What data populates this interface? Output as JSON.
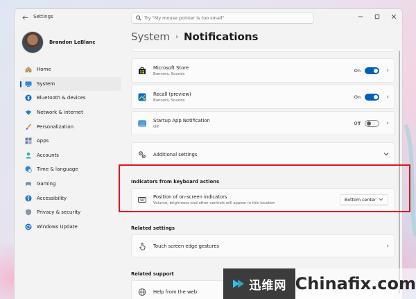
{
  "window": {
    "app_title": "Settings"
  },
  "search": {
    "placeholder": "Try \"My mouse pointer is too small\""
  },
  "profile": {
    "name": "Brandon LeBlanc"
  },
  "sidebar": {
    "items": [
      {
        "label": "Home",
        "icon": "home-icon"
      },
      {
        "label": "System",
        "icon": "system-icon",
        "active": true
      },
      {
        "label": "Bluetooth & devices",
        "icon": "bluetooth-icon"
      },
      {
        "label": "Network & internet",
        "icon": "wifi-icon"
      },
      {
        "label": "Personalization",
        "icon": "brush-icon"
      },
      {
        "label": "Apps",
        "icon": "apps-icon"
      },
      {
        "label": "Accounts",
        "icon": "person-icon"
      },
      {
        "label": "Time & language",
        "icon": "globe-clock-icon"
      },
      {
        "label": "Gaming",
        "icon": "gamepad-icon"
      },
      {
        "label": "Accessibility",
        "icon": "accessibility-icon"
      },
      {
        "label": "Privacy & security",
        "icon": "shield-icon"
      },
      {
        "label": "Windows Update",
        "icon": "update-icon"
      }
    ]
  },
  "header": {
    "parent": "System",
    "separator": "›",
    "current": "Notifications"
  },
  "notifications": [
    {
      "title": "Microsoft Store",
      "subtitle": "Banners, Sounds",
      "state_label": "On",
      "on": true,
      "icon": "store-icon"
    },
    {
      "title": "Recall (preview)",
      "subtitle": "Banners, Sounds",
      "state_label": "On",
      "on": true,
      "icon": "recall-icon"
    },
    {
      "title": "Startup App Notification",
      "subtitle": "Off",
      "state_label": "Off",
      "on": false,
      "icon": "startup-icon"
    }
  ],
  "additional_settings": {
    "label": "Additional settings"
  },
  "indicators": {
    "section_title": "Indicators from keyboard actions",
    "title": "Position of on-screen indicators",
    "subtitle": "Volume, brightness and other controls will appear in this location",
    "value": "Bottom center"
  },
  "related_settings": {
    "section_title": "Related settings",
    "item": "Touch screen edge gestures"
  },
  "related_support": {
    "section_title": "Related support",
    "item": "Help from the web"
  },
  "watermark": {
    "cn": "迅维网",
    "en": "Chinafix.com"
  },
  "colors": {
    "accent": "#005fb8",
    "highlight": "#e8101a"
  }
}
